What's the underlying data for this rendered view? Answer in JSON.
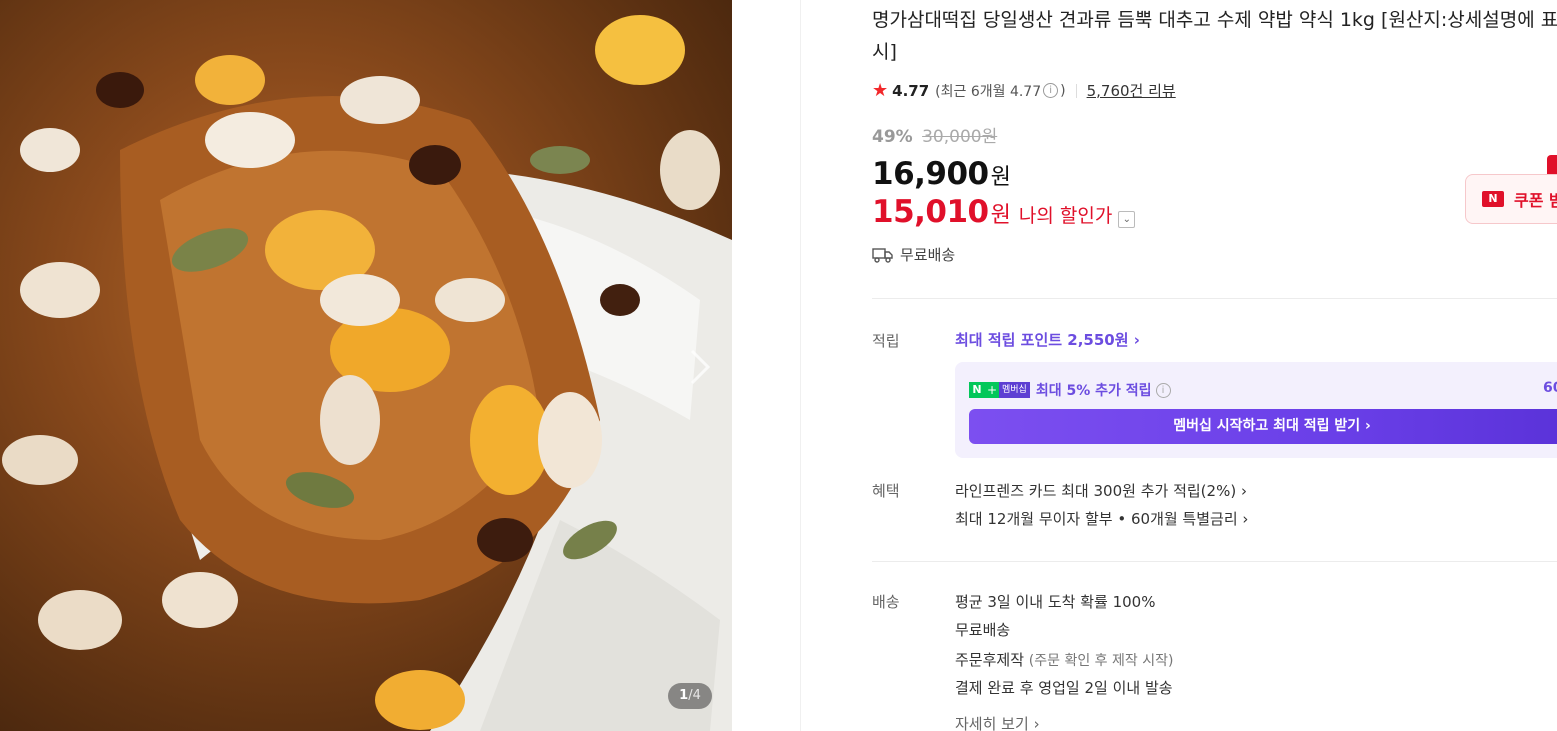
{
  "product": {
    "title": "명가삼대떡집 당일생산 견과류 듬뿍 대추고 수제 약밥 약식 1kg [원산지:상세설명에 표시]",
    "rating": "4.77",
    "recent_rating": "(최근 6개월 4.77",
    "recent_close": ")",
    "info_glyph": "i",
    "reviews": "5,760건 리뷰"
  },
  "price": {
    "discount_pct": "49%",
    "original": "30,000원",
    "sale": "16,900",
    "sale_unit": "원",
    "my_price": "15,010",
    "my_price_unit": "원",
    "my_price_label": "나의 할인가",
    "shipping": "무료배송"
  },
  "coupon": {
    "label": "쿠폰 받",
    "badge": "N"
  },
  "points": {
    "section_label": "적립",
    "max_points": "최대 적립 포인트 2,550원",
    "member_badge": {
      "n": "N",
      "plus": "+",
      "text": "멤버십"
    },
    "member_text": "최대 5% 추가 적립",
    "member_right": "60",
    "member_button": "멤버십 시작하고 최대 적립 받기"
  },
  "benefits": {
    "section_label": "혜택",
    "line1": "라인프렌즈 카드 최대 300원 추가 적립(2%)",
    "line2": "최대 12개월 무이자 할부 • 60개월 특별금리"
  },
  "delivery": {
    "section_label": "배송",
    "line1": "평균 3일 이내 도착 확률 100%",
    "line2": "무료배송",
    "line3": "주문후제작",
    "line3_sub": "(주문 확인 후 제작 시작)",
    "line4": "결제 완료 후 영업일 2일 이내 발송",
    "more": "자세히 보기"
  },
  "gallery": {
    "current": "1",
    "sep": "/",
    "total": "4"
  },
  "icons": {
    "star": "star-icon",
    "truck": "truck-icon",
    "chevron": "chevron-right-icon"
  },
  "colors": {
    "accent_red": "#e0102a",
    "membership_purple": "#6c4de0",
    "naver_green": "#03c75a"
  }
}
